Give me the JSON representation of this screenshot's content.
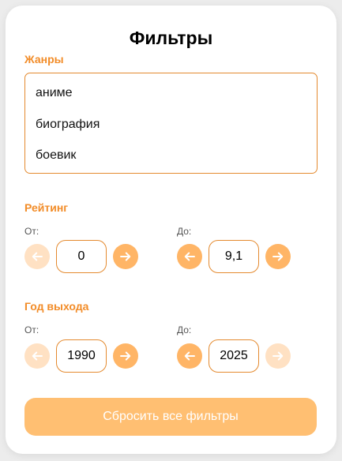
{
  "title": "Фильтры",
  "genres": {
    "label": "Жанры",
    "items": [
      "аниме",
      "биография",
      "боевик"
    ]
  },
  "rating": {
    "label": "Рейтинг",
    "from_label": "От:",
    "to_label": "До:",
    "from_value": "0",
    "to_value": "9,1"
  },
  "year": {
    "label": "Год выхода",
    "from_label": "От:",
    "to_label": "До:",
    "from_value": "1990",
    "to_value": "2025"
  },
  "reset_label": "Сбросить все фильтры",
  "colors": {
    "accent": "#f28c28",
    "button_active": "#ffb566",
    "button_disabled": "#ffe1c3",
    "reset_button": "#ffbf72"
  },
  "icons": {
    "left": "arrow-left-icon",
    "right": "arrow-right-icon"
  }
}
